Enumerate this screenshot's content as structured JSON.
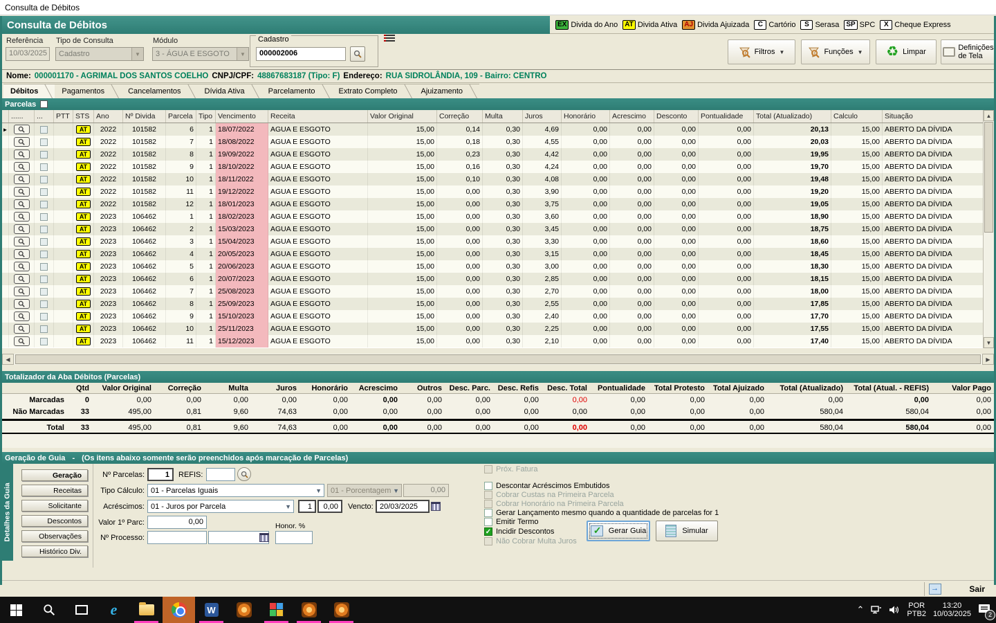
{
  "window": {
    "title": "Consulta de Débitos"
  },
  "header": {
    "title": "Consulta de Débitos",
    "legend": [
      {
        "code": "EX",
        "label": "Divida do Ano",
        "bg": "#3cb43c",
        "fg": "#000000"
      },
      {
        "code": "AT",
        "label": "Divida Ativa",
        "bg": "#ffff00",
        "fg": "#000000"
      },
      {
        "code": "AJ",
        "label": "Divida Ajuizada",
        "bg": "#e0912e",
        "fg": "#b00000"
      },
      {
        "code": "C",
        "label": "Cartório",
        "bg": "#ffffff",
        "fg": "#000000"
      },
      {
        "code": "S",
        "label": "Serasa",
        "bg": "#ffffff",
        "fg": "#000000"
      },
      {
        "code": "SP",
        "label": "SPC",
        "bg": "#ffffff",
        "fg": "#000000"
      },
      {
        "code": "X",
        "label": "Cheque Express",
        "bg": "#ffffff",
        "fg": "#000000"
      }
    ]
  },
  "form": {
    "referencia_label": "Referência",
    "referencia_value": "10/03/2025",
    "tipo_label": "Tipo de Consulta",
    "tipo_value": "Cadastro",
    "modulo_label": "Módulo",
    "modulo_value": "3 - ÁGUA E ESGOTO",
    "cadastro_label": "Cadastro",
    "cadastro_value": "000002006"
  },
  "toolbar": {
    "filtros": "Filtros",
    "funcoes": "Funções",
    "limpar": "Limpar",
    "definicoes_l1": "Definições",
    "definicoes_l2": "de Tela"
  },
  "person": {
    "nome_label": "Nome:",
    "nome_value": "000001170 - AGRIMAL DOS SANTOS COELHO",
    "cnpj_label": "CNPJ/CPF:",
    "cnpj_value": "48867683187 (Tipo: F)",
    "endereco_label": "Endereço:",
    "endereco_value": "RUA SIDROLÂNDIA, 109 - Bairro: CENTRO"
  },
  "tabs": {
    "active_index": 0,
    "items": [
      "Débitos",
      "Pagamentos",
      "Cancelamentos",
      "Dívida Ativa",
      "Parcelamento",
      "Extrato Completo",
      "Ajuizamento"
    ]
  },
  "parcelas_bar": {
    "label": "Parcelas"
  },
  "grid": {
    "status_badge": "AT",
    "columns": [
      "",
      "......",
      "...",
      "PTT",
      "STS",
      "Ano",
      "Nº Divida",
      "Parcela",
      "Tipo",
      "Vencimento",
      "Receita",
      "Valor Original",
      "Correção",
      "Multa",
      "Juros",
      "Honorário",
      "Acrescimo",
      "Desconto",
      "Pontualidade",
      "Total (Atualizado)",
      "Calculo",
      "Situação"
    ],
    "rows": [
      [
        "2022",
        "101582",
        "6",
        "1",
        "18/07/2022",
        "AGUA E ESGOTO",
        "15,00",
        "0,14",
        "0,30",
        "4,69",
        "0,00",
        "0,00",
        "0,00",
        "0,00",
        "20,13",
        "15,00",
        "ABERTO DA DÍVIDA"
      ],
      [
        "2022",
        "101582",
        "7",
        "1",
        "18/08/2022",
        "AGUA E ESGOTO",
        "15,00",
        "0,18",
        "0,30",
        "4,55",
        "0,00",
        "0,00",
        "0,00",
        "0,00",
        "20,03",
        "15,00",
        "ABERTO DA DÍVIDA"
      ],
      [
        "2022",
        "101582",
        "8",
        "1",
        "19/09/2022",
        "AGUA E ESGOTO",
        "15,00",
        "0,23",
        "0,30",
        "4,42",
        "0,00",
        "0,00",
        "0,00",
        "0,00",
        "19,95",
        "15,00",
        "ABERTO DA DÍVIDA"
      ],
      [
        "2022",
        "101582",
        "9",
        "1",
        "18/10/2022",
        "AGUA E ESGOTO",
        "15,00",
        "0,16",
        "0,30",
        "4,24",
        "0,00",
        "0,00",
        "0,00",
        "0,00",
        "19,70",
        "15,00",
        "ABERTO DA DÍVIDA"
      ],
      [
        "2022",
        "101582",
        "10",
        "1",
        "18/11/2022",
        "AGUA E ESGOTO",
        "15,00",
        "0,10",
        "0,30",
        "4,08",
        "0,00",
        "0,00",
        "0,00",
        "0,00",
        "19,48",
        "15,00",
        "ABERTO DA DÍVIDA"
      ],
      [
        "2022",
        "101582",
        "11",
        "1",
        "19/12/2022",
        "AGUA E ESGOTO",
        "15,00",
        "0,00",
        "0,30",
        "3,90",
        "0,00",
        "0,00",
        "0,00",
        "0,00",
        "19,20",
        "15,00",
        "ABERTO DA DÍVIDA"
      ],
      [
        "2022",
        "101582",
        "12",
        "1",
        "18/01/2023",
        "AGUA E ESGOTO",
        "15,00",
        "0,00",
        "0,30",
        "3,75",
        "0,00",
        "0,00",
        "0,00",
        "0,00",
        "19,05",
        "15,00",
        "ABERTO DA DÍVIDA"
      ],
      [
        "2023",
        "106462",
        "1",
        "1",
        "18/02/2023",
        "AGUA E ESGOTO",
        "15,00",
        "0,00",
        "0,30",
        "3,60",
        "0,00",
        "0,00",
        "0,00",
        "0,00",
        "18,90",
        "15,00",
        "ABERTO DA DÍVIDA"
      ],
      [
        "2023",
        "106462",
        "2",
        "1",
        "15/03/2023",
        "AGUA E ESGOTO",
        "15,00",
        "0,00",
        "0,30",
        "3,45",
        "0,00",
        "0,00",
        "0,00",
        "0,00",
        "18,75",
        "15,00",
        "ABERTO DA DÍVIDA"
      ],
      [
        "2023",
        "106462",
        "3",
        "1",
        "15/04/2023",
        "AGUA E ESGOTO",
        "15,00",
        "0,00",
        "0,30",
        "3,30",
        "0,00",
        "0,00",
        "0,00",
        "0,00",
        "18,60",
        "15,00",
        "ABERTO DA DÍVIDA"
      ],
      [
        "2023",
        "106462",
        "4",
        "1",
        "20/05/2023",
        "AGUA E ESGOTO",
        "15,00",
        "0,00",
        "0,30",
        "3,15",
        "0,00",
        "0,00",
        "0,00",
        "0,00",
        "18,45",
        "15,00",
        "ABERTO DA DÍVIDA"
      ],
      [
        "2023",
        "106462",
        "5",
        "1",
        "20/06/2023",
        "AGUA E ESGOTO",
        "15,00",
        "0,00",
        "0,30",
        "3,00",
        "0,00",
        "0,00",
        "0,00",
        "0,00",
        "18,30",
        "15,00",
        "ABERTO DA DÍVIDA"
      ],
      [
        "2023",
        "106462",
        "6",
        "1",
        "20/07/2023",
        "AGUA E ESGOTO",
        "15,00",
        "0,00",
        "0,30",
        "2,85",
        "0,00",
        "0,00",
        "0,00",
        "0,00",
        "18,15",
        "15,00",
        "ABERTO DA DÍVIDA"
      ],
      [
        "2023",
        "106462",
        "7",
        "1",
        "25/08/2023",
        "AGUA E ESGOTO",
        "15,00",
        "0,00",
        "0,30",
        "2,70",
        "0,00",
        "0,00",
        "0,00",
        "0,00",
        "18,00",
        "15,00",
        "ABERTO DA DÍVIDA"
      ],
      [
        "2023",
        "106462",
        "8",
        "1",
        "25/09/2023",
        "AGUA E ESGOTO",
        "15,00",
        "0,00",
        "0,30",
        "2,55",
        "0,00",
        "0,00",
        "0,00",
        "0,00",
        "17,85",
        "15,00",
        "ABERTO DA DÍVIDA"
      ],
      [
        "2023",
        "106462",
        "9",
        "1",
        "15/10/2023",
        "AGUA E ESGOTO",
        "15,00",
        "0,00",
        "0,30",
        "2,40",
        "0,00",
        "0,00",
        "0,00",
        "0,00",
        "17,70",
        "15,00",
        "ABERTO DA DÍVIDA"
      ],
      [
        "2023",
        "106462",
        "10",
        "1",
        "25/11/2023",
        "AGUA E ESGOTO",
        "15,00",
        "0,00",
        "0,30",
        "2,25",
        "0,00",
        "0,00",
        "0,00",
        "0,00",
        "17,55",
        "15,00",
        "ABERTO DA DÍVIDA"
      ],
      [
        "2023",
        "106462",
        "11",
        "1",
        "15/12/2023",
        "AGUA E ESGOTO",
        "15,00",
        "0,00",
        "0,30",
        "2,10",
        "0,00",
        "0,00",
        "0,00",
        "0,00",
        "17,40",
        "15,00",
        "ABERTO DA DÍVIDA"
      ]
    ]
  },
  "totalizador": {
    "title": "Totalizador da Aba Débitos (Parcelas)",
    "columns": [
      "",
      "Qtd",
      "Valor Original",
      "Correção",
      "Multa",
      "Juros",
      "Honorário",
      "Acrescimo",
      "Outros",
      "Desc. Parc.",
      "Desc. Refis",
      "Desc. Total",
      "Pontualidade",
      "Total Protesto",
      "Total Ajuizado",
      "Total (Atualizado)",
      "Total (Atual. - REFIS)",
      "Valor Pago"
    ],
    "marcadas": [
      "Marcadas",
      "0",
      "0,00",
      "0,00",
      "0,00",
      "0,00",
      "0,00",
      "0,00",
      "0,00",
      "0,00",
      "0,00",
      "0,00",
      "0,00",
      "0,00",
      "0,00",
      "0,00",
      "0,00",
      "0,00"
    ],
    "nao_marcadas": [
      "Não Marcadas",
      "33",
      "495,00",
      "0,81",
      "9,60",
      "74,63",
      "0,00",
      "0,00",
      "0,00",
      "0,00",
      "0,00",
      "0,00",
      "0,00",
      "0,00",
      "0,00",
      "580,04",
      "580,04",
      "0,00"
    ],
    "total": [
      "Total",
      "33",
      "495,00",
      "0,81",
      "9,60",
      "74,63",
      "0,00",
      "0,00",
      "0,00",
      "0,00",
      "0,00",
      "0,00",
      "0,00",
      "0,00",
      "0,00",
      "580,04",
      "580,04",
      "0,00"
    ]
  },
  "guia": {
    "title": "Geração de Guia",
    "title_sep": "-",
    "subtitle": "(Os itens abaixo somente serão preenchidos após marcação de Parcelas)",
    "side_tab": "Detalhes da Guia",
    "side_buttons": [
      "Geração",
      "Receitas",
      "Solicitante",
      "Descontos",
      "Observações",
      "Histórico Div."
    ],
    "fields": {
      "num_parcelas_label": "Nº Parcelas:",
      "num_parcelas_value": "1",
      "refis_label": "REFIS:",
      "refis_value": "",
      "tipo_calculo_label": "Tipo Cálculo:",
      "tipo_calculo_value": "01 - Parcelas Iguais",
      "porcentagem_value": "01 - Porcentagem",
      "porcentagem_amount": "0,00",
      "acrescimos_label": "Acréscimos:",
      "acrescimos_value": "01 - Juros por Parcela",
      "acrescimos_n": "1",
      "acrescimos_amount": "0,00",
      "vencto_label": "Vencto:",
      "vencto_value": "20/03/2025",
      "valor1_label": "Valor 1º Parc:",
      "valor1_value": "0,00",
      "honor_label": "Honor. %",
      "processo_label": "Nº Processo:"
    },
    "checkboxes": [
      {
        "label": "Próx. Fatura",
        "checked": false,
        "disabled": true
      },
      {
        "label": "Descontar Acréscimos Embutidos",
        "checked": false,
        "disabled": false
      },
      {
        "label": "Cobrar Custas na Primeira Parcela",
        "checked": false,
        "disabled": true
      },
      {
        "label": "Cobrar Honorário na Primeira Parcela",
        "checked": false,
        "disabled": true
      },
      {
        "label": "Gerar Lançamento mesmo quando a quantidade de parcelas for 1",
        "checked": false,
        "disabled": false
      },
      {
        "label": "Emitir Termo",
        "checked": false,
        "disabled": false
      },
      {
        "label": "Incidir Descontos",
        "checked": true,
        "disabled": false
      },
      {
        "label": "Não Cobrar Multa Juros",
        "checked": false,
        "disabled": true
      }
    ],
    "buttons": {
      "gerar": "Gerar Guia",
      "simular": "Simular"
    }
  },
  "statusbar": {
    "sair": "Sair"
  },
  "taskbar": {
    "icons": [
      {
        "name": "start"
      },
      {
        "name": "search"
      },
      {
        "name": "task-view"
      },
      {
        "name": "internet-explorer"
      },
      {
        "name": "file-explorer",
        "running": true
      },
      {
        "name": "chrome",
        "active": true
      },
      {
        "name": "word",
        "running": true
      },
      {
        "name": "app-sun-1"
      },
      {
        "name": "app-grid",
        "running": true
      },
      {
        "name": "app-sun-2",
        "running": true
      },
      {
        "name": "app-sun-3",
        "running": true
      }
    ],
    "tray": {
      "lang1": "POR",
      "lang2": "PTB2",
      "time": "13:20",
      "date": "10/03/2025",
      "badge": "2"
    }
  }
}
